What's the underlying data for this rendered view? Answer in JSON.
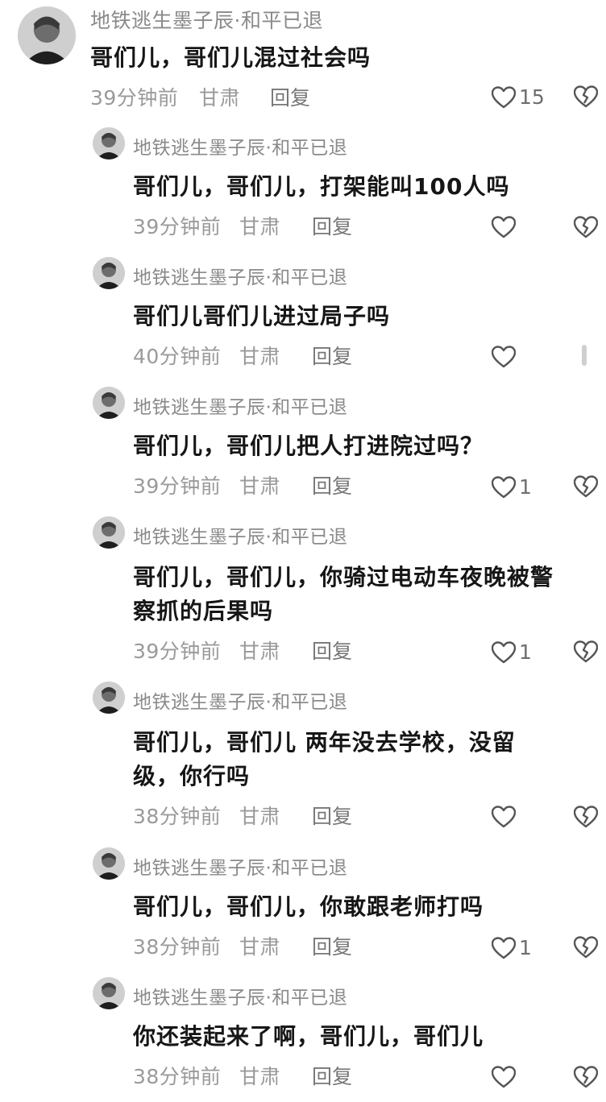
{
  "comments": [
    {
      "username": "地铁逃生墨子辰·和平已退",
      "text": [
        "哥们儿，哥们儿混过社会吗"
      ],
      "time": "39分钟前",
      "location": "甘肃",
      "reply_label": "回复",
      "likes": "15"
    },
    {
      "username": "地铁逃生墨子辰·和平已退",
      "text": [
        "哥们儿，哥们儿，打架能叫100人吗"
      ],
      "time": "39分钟前",
      "location": "甘肃",
      "reply_label": "回复",
      "likes": ""
    },
    {
      "username": "地铁逃生墨子辰·和平已退",
      "text": [
        "哥们儿哥们儿进过局子吗"
      ],
      "time": "40分钟前",
      "location": "甘肃",
      "reply_label": "回复",
      "likes": ""
    },
    {
      "username": "地铁逃生墨子辰·和平已退",
      "text": [
        "哥们儿，哥们儿把人打进院过吗？"
      ],
      "time": "39分钟前",
      "location": "甘肃",
      "reply_label": "回复",
      "likes": "1"
    },
    {
      "username": "地铁逃生墨子辰·和平已退",
      "text": [
        "哥们儿，哥们儿，你骑过电动车夜晚被警",
        "察抓的后果吗"
      ],
      "time": "39分钟前",
      "location": "甘肃",
      "reply_label": "回复",
      "likes": "1"
    },
    {
      "username": "地铁逃生墨子辰·和平已退",
      "text": [
        "哥们儿，哥们儿 两年没去学校，没留",
        "级，你行吗"
      ],
      "time": "38分钟前",
      "location": "甘肃",
      "reply_label": "回复",
      "likes": ""
    },
    {
      "username": "地铁逃生墨子辰·和平已退",
      "text": [
        "哥们儿，哥们儿，你敢跟老师打吗"
      ],
      "time": "38分钟前",
      "location": "甘肃",
      "reply_label": "回复",
      "likes": "1"
    },
    {
      "username": "地铁逃生墨子辰·和平已退",
      "text": [
        "你还装起来了啊，哥们儿，哥们儿"
      ],
      "time": "38分钟前",
      "location": "甘肃",
      "reply_label": "回复",
      "likes": ""
    }
  ],
  "icons": {
    "like": "heart-outline-icon",
    "dislike": "broken-heart-icon"
  },
  "colors": {
    "username": "#8a8a8a",
    "text": "#161616",
    "meta": "#9a9a9a",
    "icon": "#555555"
  }
}
